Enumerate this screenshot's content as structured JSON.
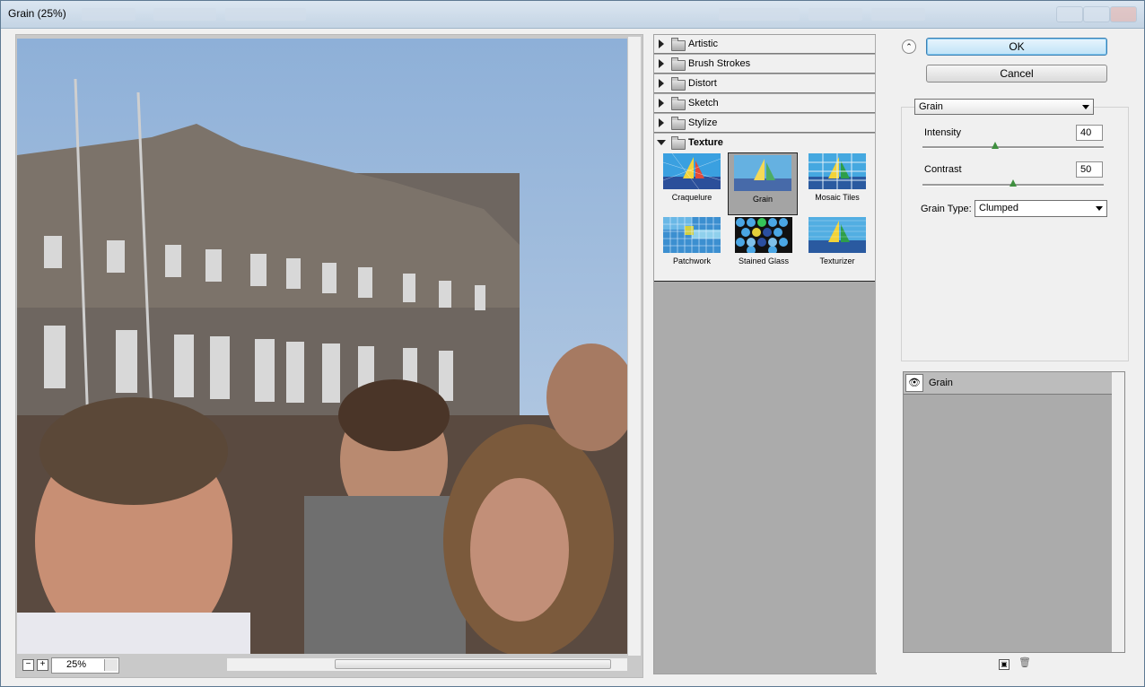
{
  "window": {
    "title": "Grain (25%)"
  },
  "preview": {
    "zoom_value": "25%",
    "zoom_out": "−",
    "zoom_in": "+"
  },
  "gallery": {
    "folders": [
      {
        "label": "Artistic",
        "expanded": false
      },
      {
        "label": "Brush Strokes",
        "expanded": false
      },
      {
        "label": "Distort",
        "expanded": false
      },
      {
        "label": "Sketch",
        "expanded": false
      },
      {
        "label": "Stylize",
        "expanded": false
      },
      {
        "label": "Texture",
        "expanded": true
      }
    ],
    "texture_filters": [
      {
        "label": "Craquelure",
        "selected": false
      },
      {
        "label": "Grain",
        "selected": true
      },
      {
        "label": "Mosaic Tiles",
        "selected": false
      },
      {
        "label": "Patchwork",
        "selected": false
      },
      {
        "label": "Stained Glass",
        "selected": false
      },
      {
        "label": "Texturizer",
        "selected": false
      }
    ]
  },
  "buttons": {
    "ok": "OK",
    "cancel": "Cancel"
  },
  "filter_select": {
    "value": "Grain"
  },
  "params": {
    "intensity": {
      "label": "Intensity",
      "value": "40",
      "fraction": 0.4
    },
    "contrast": {
      "label": "Contrast",
      "value": "50",
      "fraction": 0.5
    },
    "grain_type": {
      "label": "Grain Type:",
      "value": "Clumped"
    }
  },
  "layers": {
    "items": [
      {
        "label": "Grain",
        "visible": true
      }
    ]
  },
  "colors": {
    "accent": "#7ec6f0",
    "gallery_bg": "#ababab",
    "panel_bg": "#f0f0f0"
  }
}
